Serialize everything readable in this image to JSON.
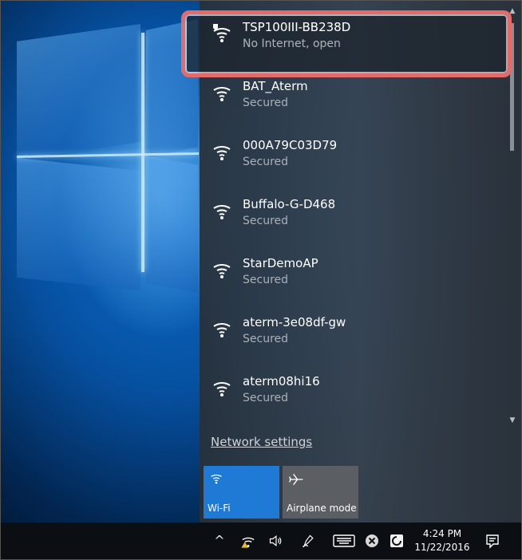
{
  "networks": [
    {
      "name": "TSP100III-BB238D",
      "status": "No Internet, open",
      "icon": "wifi-warning-icon"
    },
    {
      "name": "BAT_Aterm",
      "status": "Secured",
      "icon": "wifi-icon"
    },
    {
      "name": "000A79C03D79",
      "status": "Secured",
      "icon": "wifi-icon"
    },
    {
      "name": "Buffalo-G-D468",
      "status": "Secured",
      "icon": "wifi-icon"
    },
    {
      "name": "StarDemoAP",
      "status": "Secured",
      "icon": "wifi-icon"
    },
    {
      "name": "aterm-3e08df-gw",
      "status": "Secured",
      "icon": "wifi-icon"
    },
    {
      "name": "aterm08hi16",
      "status": "Secured",
      "icon": "wifi-icon"
    }
  ],
  "network_settings_label": "Network settings",
  "quick_actions": [
    {
      "label": "Wi-Fi",
      "state": "on",
      "color": "#1f7ad6"
    },
    {
      "label": "Airplane mode",
      "state": "off",
      "color": "#5b5f63"
    }
  ],
  "taskbar": {
    "time": "4:24 PM",
    "date": "11/22/2016"
  },
  "colors": {
    "highlight": "#e56a6a",
    "accent": "#1f7ad6"
  }
}
